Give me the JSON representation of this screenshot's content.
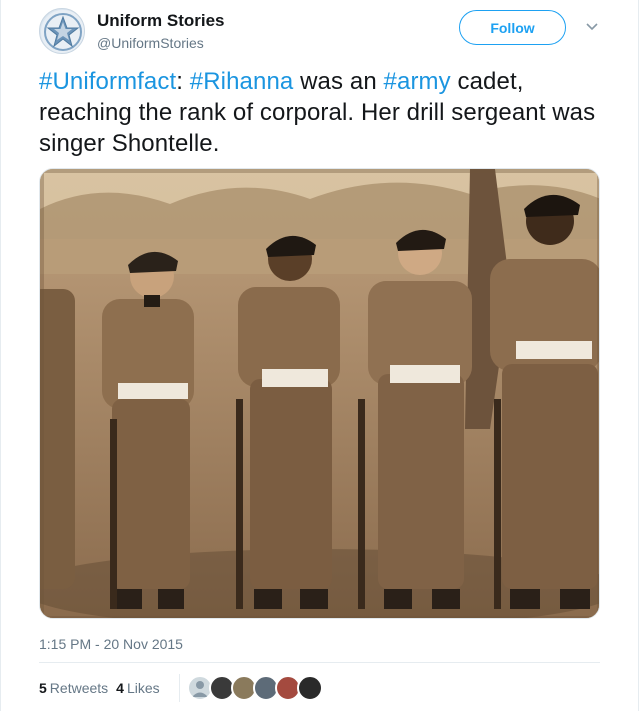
{
  "account": {
    "name": "Uniform Stories",
    "handle": "@UniformStories",
    "avatar_icon": "star-logo-icon"
  },
  "actions": {
    "follow_label": "Follow",
    "more_icon": "chevron-down-icon"
  },
  "tweet": {
    "segments": [
      {
        "text": "#Uniformfact",
        "hashtag": true
      },
      {
        "text": ": ",
        "hashtag": false
      },
      {
        "text": "#Rihanna",
        "hashtag": true
      },
      {
        "text": " was an ",
        "hashtag": false
      },
      {
        "text": "#army",
        "hashtag": true
      },
      {
        "text": " cadet, reaching the rank of corporal. Her drill sergeant was singer Shontelle.",
        "hashtag": false
      }
    ],
    "photo_icon": "cadets-photo"
  },
  "meta": {
    "timestamp": "1:15 PM - 20 Nov 2015",
    "retweets_count": "5",
    "retweets_label": "Retweets",
    "likes_count": "4",
    "likes_label": "Likes"
  },
  "likers": [
    {
      "color": "#cfd9de"
    },
    {
      "color": "#3a3a3a"
    },
    {
      "color": "#8a7a5c"
    },
    {
      "color": "#5d6b78"
    },
    {
      "color": "#a44a3f"
    },
    {
      "color": "#2a2a2a"
    }
  ],
  "colors": {
    "accent": "#1da1f2",
    "hashtag": "#1b95e0",
    "muted": "#657786"
  }
}
